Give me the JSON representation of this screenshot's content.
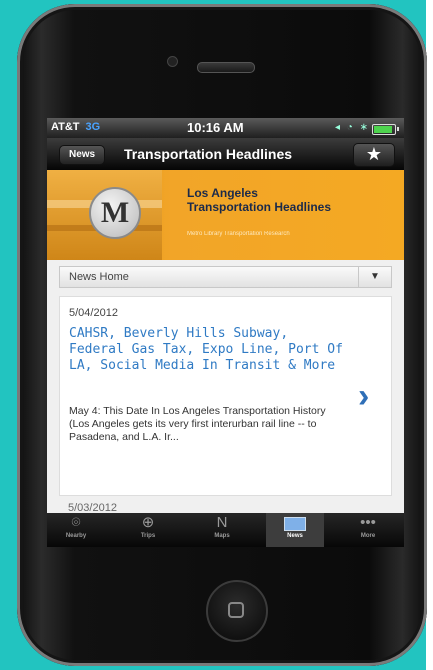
{
  "status_bar": {
    "carrier": "AT&T",
    "network": "3G",
    "time": "10:16 AM",
    "system_icons": "◂ ◔ ∗",
    "battery_level": 0.9
  },
  "nav": {
    "back_label": "News",
    "title": "Transportation Headlines",
    "star_icon": "★"
  },
  "banner": {
    "logo_letter": "M",
    "title_line1": "Los Angeles",
    "title_line2": "Transportation Headlines",
    "subtitle": "Metro Library Transportation Research"
  },
  "section": {
    "label": "News Home",
    "toggle_icon": "▼"
  },
  "article": {
    "date": "5/04/2012",
    "title": "CAHSR, Beverly Hills Subway, Federal Gas Tax, Expo Line, Port Of LA, Social Media In Transit & More",
    "summary": "May 4: This Date In Los Angeles Transportation History (Los Angeles gets its very first interurban rail line -- to Pasadena, and L.A. Ir...",
    "chevron": "›"
  },
  "next_article_date": "5/03/2012",
  "tabs": [
    {
      "label": "Nearby",
      "icon": "⌾"
    },
    {
      "label": "Trips",
      "icon": "⊕"
    },
    {
      "label": "Maps",
      "icon": "N"
    },
    {
      "label": "News",
      "icon": "news"
    },
    {
      "label": "More",
      "icon": "•••"
    }
  ],
  "colors": {
    "background": "#22c4c0",
    "accent": "#2f7ac4",
    "banner": "#f2a528"
  }
}
